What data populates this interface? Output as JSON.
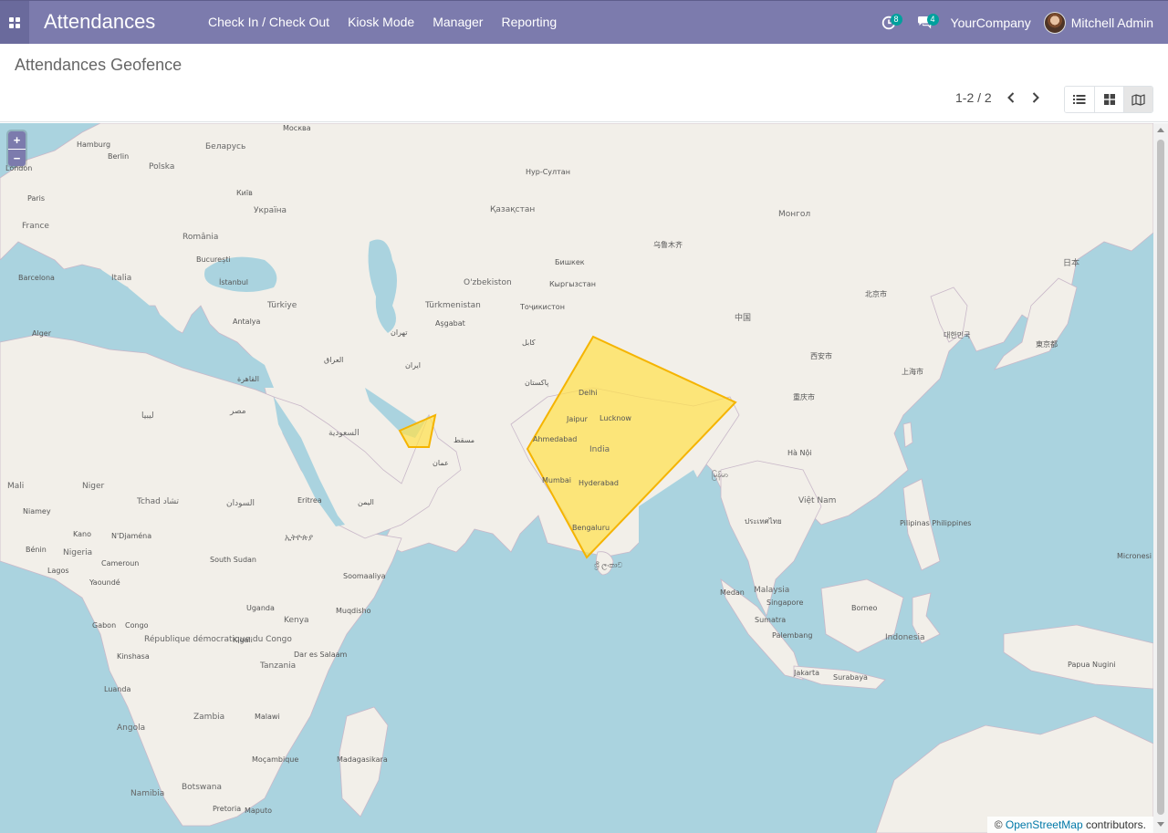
{
  "app": {
    "title": "Attendances"
  },
  "menu": [
    {
      "label": "Check In / Check Out"
    },
    {
      "label": "Kiosk Mode"
    },
    {
      "label": "Manager"
    },
    {
      "label": "Reporting"
    }
  ],
  "systray": {
    "activities_count": "8",
    "messages_count": "4",
    "company": "YourCompany",
    "user": "Mitchell Admin"
  },
  "control_panel": {
    "title": "Attendances Geofence",
    "pager": "1-2 / 2",
    "views": [
      "list-view",
      "kanban-view",
      "map-view"
    ],
    "active_view": "map-view"
  },
  "map": {
    "zoom_in": "+",
    "zoom_out": "−",
    "attribution_prefix": "©",
    "attribution_link": "OpenStreetMap",
    "attribution_suffix": "contributors.",
    "geofence_color": "#ffe14d",
    "geofence_border": "#f5b400",
    "labels": {
      "moscow": "Москва",
      "london": "London",
      "hamburg": "Hamburg",
      "berlin": "Berlin",
      "paris": "Paris",
      "france": "France",
      "barcelona": "Barcelona",
      "italia": "Italia",
      "belarus": "Беларусь",
      "ukraine": "Україна",
      "kyiv": "Київ",
      "polska": "Polska",
      "romania": "România",
      "bucuresti": "București",
      "istanbul": "İstanbul",
      "turkiye": "Türkiye",
      "ankara": "Antalya",
      "kazakhstan": "Қазақстан",
      "nursultan": "Нур-Султан",
      "uzbekistan": "O'zbekiston",
      "turkmenistan": "Türkmenistan",
      "ashgabat": "Aşgabat",
      "bishkek": "Бишкек",
      "kyrgyzstan": "Кыргызстан",
      "tajikistan": "Тоҷикистон",
      "urumqi": "乌鲁木齐",
      "mongolia": "Монгол",
      "china": "中国",
      "beijing": "北京市",
      "shanghai": "上海市",
      "chongqing": "重庆市",
      "xian": "西安市",
      "korea": "대한민국",
      "japan": "日本",
      "tokyo": "東京都",
      "india": "India",
      "delhi": "Delhi",
      "jaipur": "Jaipur",
      "lucknow": "Lucknow",
      "ahmedabad": "Ahmedabad",
      "mumbai": "Mumbai",
      "hyderabad": "Hyderabad",
      "bengaluru": "Bengaluru",
      "pakistan": "پاکستان",
      "kabul": "کابل",
      "iran": "ایران",
      "tehran": "تهران",
      "iraq": "العراق",
      "saudi": "السعودية",
      "muscat": "مسقط",
      "oman": "عمان",
      "yemen": "اليمن",
      "egypt": "مصر",
      "cairo": "القاهرة",
      "libya": "ليبيا",
      "algeria": "Alger",
      "sudan": "السودان",
      "chad": "Tchad تشاد",
      "niger": "Niger",
      "nigeria": "Nigeria",
      "ethiopia": "ኢትዮጵያ",
      "south_sudan": "South Sudan",
      "somalia": "Soomaaliya",
      "kenya": "Kenya",
      "uganda": "Uganda",
      "tanzania": "Tanzania",
      "mogadishu": "Muqdisho",
      "dar": "Dar es Salaam",
      "kinshasa": "Kinshasa",
      "zambia": "Zambia",
      "malawi": "Malawi",
      "mozambique": "Moçambique",
      "madagascar": "Madagasikara",
      "botswana": "Botswana",
      "namibia": "Namibia",
      "pretoria": "Pretoria",
      "maputo": "Maputo",
      "srilanka": "ශ්‍රී ලංකාව",
      "myanmar": "မြန်မာ",
      "thailand": "ประเทศไทย",
      "vietnam": "Việt Nam",
      "hanoi": "Hà Nội",
      "philippines": "Pilipinas Philippines",
      "malaysia": "Malaysia",
      "singapore": "Singapore",
      "medan": "Medan",
      "indonesia": "Indonesia",
      "jakarta": "Jakarta",
      "surabaya": "Surabaya",
      "borneo": "Borneo",
      "papua": "Papua Nugini",
      "sumatra": "Sumatra",
      "palembang": "Palembang",
      "micronesia": "Micronesi",
      "eritrea": "Eritrea",
      "angola": "Angola",
      "gabon": "Gabon",
      "congo": "Congo",
      "rdc": "République démocratique du Congo",
      "luanda": "Luanda",
      "kigali": "Kigali",
      "yaounde": "Yaoundé",
      "lagos": "Lagos",
      "mali": "Mali",
      "niamey": "Niamey",
      "ndjamena": "N'Djaména",
      "kano": "Kano",
      "benin": "Bénin",
      "cameroun": "Cameroun"
    }
  }
}
